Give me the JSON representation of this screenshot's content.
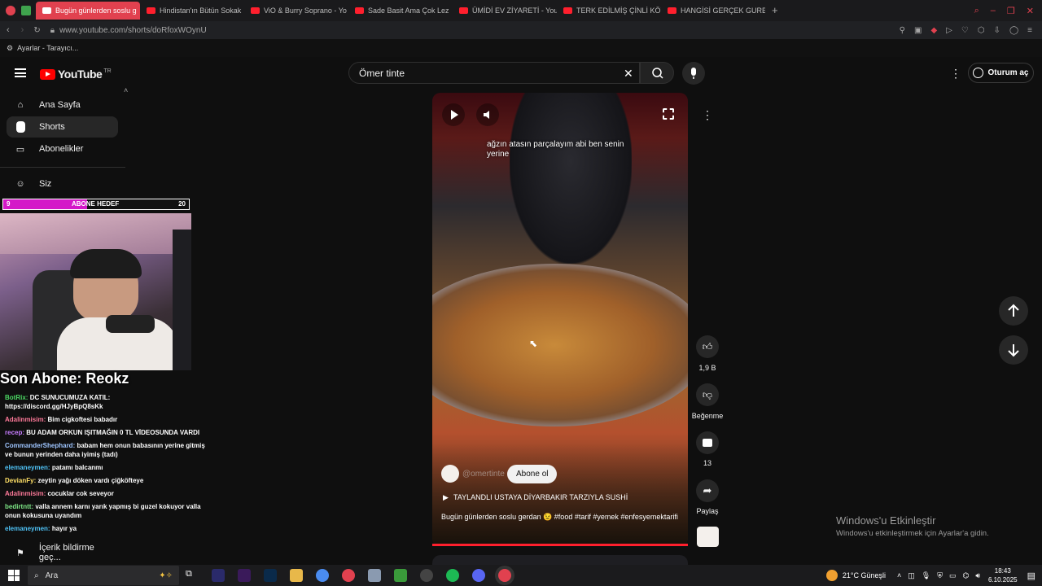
{
  "browser": {
    "tabs": [
      {
        "label": "Bugün günlerden soslu g",
        "active": true
      },
      {
        "label": "Hindistan'ın Bütün Sokak",
        "active": false
      },
      {
        "label": "ViO & Burry Soprano - Yo",
        "active": false
      },
      {
        "label": "Sade Basit Ama Çok Lez",
        "active": false
      },
      {
        "label": "ÜMİDİ EV ZİYARETİ - You",
        "active": false
      },
      {
        "label": "TERK EDİLMİŞ ÇİNLİ KÖY",
        "active": false
      },
      {
        "label": "HANGİSİ GERÇEK GURBE",
        "active": false
      }
    ],
    "url": "www.youtube.com/shorts/doRfoxWOynU",
    "settings_label": "Ayarlar - Tarayıcı..."
  },
  "header": {
    "logo_text": "YouTube",
    "region": "TR",
    "search_value": "Ömer tinte",
    "signin_label": "Oturum aç"
  },
  "sidebar": {
    "items": [
      {
        "label": "Ana Sayfa",
        "icon": "home-icon"
      },
      {
        "label": "Shorts",
        "icon": "shorts-icon"
      },
      {
        "label": "Abonelikler",
        "icon": "subscriptions-icon"
      },
      {
        "label": "Siz",
        "icon": "user-icon"
      },
      {
        "label": "İçerik bildirme geç...",
        "icon": "flag-icon"
      }
    ]
  },
  "overlay": {
    "goal_left": "9",
    "goal_label": "ABONE HEDEF",
    "goal_right": "20",
    "goal_fraction": 0.45,
    "last_sub": "Son Abone: Reokz",
    "chat": [
      {
        "user": "BotRix:",
        "text": "DC SUNUCUMUZA KATIL: https://discord.gg/HJyBpQ8sKk",
        "color": "#4cd964"
      },
      {
        "user": "Adalinmisim:",
        "text": "Bim cigkoftesi babadır",
        "color": "#ff7a9a"
      },
      {
        "user": "recep:",
        "text": "BU ADAM ORKUN IŞITMAĞIN 0 TL VİDEOSUNDA VARDI",
        "color": "#c77dff"
      },
      {
        "user": "CommanderShephard:",
        "text": "babam hem onun babasının yerine gitmiş ve bunun yerinden daha iyimiş (tadı)",
        "color": "#9ec5ff"
      },
      {
        "user": "elemaneymen:",
        "text": "patamı balcanmı",
        "color": "#4fc3f7"
      },
      {
        "user": "DevianFy:",
        "text": "zeytin yağı döken vardı çiğköfteye",
        "color": "#ffe066"
      },
      {
        "user": "Adalinmisim:",
        "text": "cocuklar cok seveyor",
        "color": "#ff7a9a"
      },
      {
        "user": "bedirtntt:",
        "text": "valla annem karnı yarık yapmış bi guzel kokuyor valla onun kokusuna uyandım",
        "color": "#7ee787"
      },
      {
        "user": "elemaneymen:",
        "text": "hayır ya",
        "color": "#4fc3f7"
      }
    ]
  },
  "short": {
    "caption": "ağzın atasın parçalayım abi ben senin yerine",
    "channel": "@omertinte",
    "subscribe_label": "Abone ol",
    "music": "TAYLANDLI USTAYA DİYARBAKIR TARZIYLA SUSHİ",
    "description": "Bugün günlerden soslu gerdan 😉 #food #tarif #yemek #enfesyemektarifi",
    "likes": "1,9 B",
    "dislike_label": "Beğenme",
    "comments": "13",
    "share_label": "Paylaş"
  },
  "windows_activation": {
    "title": "Windows'u Etkinleştir",
    "subtitle": "Windows'u etkinleştirmek için Ayarlar'a gidin."
  },
  "taskbar": {
    "search_placeholder": "Ara",
    "weather": "21°C  Güneşli",
    "time": "18:43",
    "date": "6.10.2025"
  }
}
